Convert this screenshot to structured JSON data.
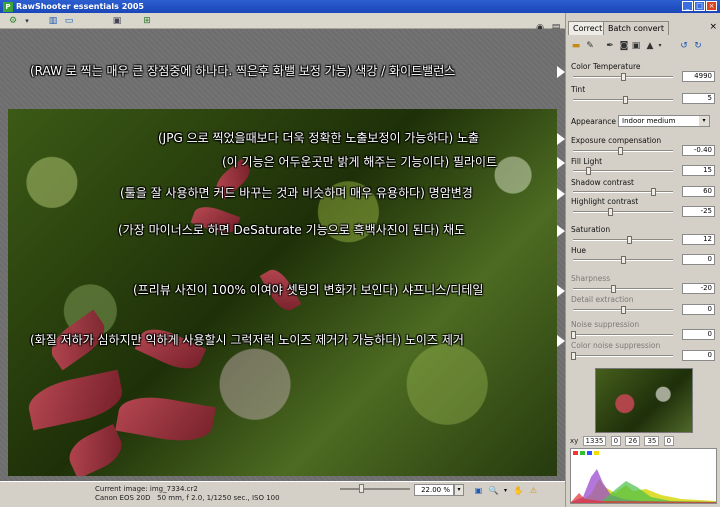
{
  "window": {
    "title": "RawShooter essentials 2005",
    "app_icon": "P",
    "buttons": [
      "_",
      "□",
      "×"
    ]
  },
  "toolbar": {
    "icons": [
      "settings-icon",
      "chevron-down-icon",
      "single-view-icon",
      "compare-view-icon",
      "monitor-icon",
      "batch-icon"
    ]
  },
  "annotations": [
    {
      "text": "(RAW 로 찍는 매우 큰 장점중에 하나다. 찍은후 화밸 보정 가능) 색강 / 화이트밸런스"
    },
    {
      "text": "(JPG 으로 찍었을때보다 더욱 정확한 노출보정이 가능하다) 노출"
    },
    {
      "text": "(이 기능은 어두운곳만 밝게 해주는 기능이다) 필라이트"
    },
    {
      "text": "(툴을 잘 사용하면 커드 바꾸는 것과 비슷하며 매우 유용하다) 명암변경"
    },
    {
      "text": "(가장 마이너스로 하면 DeSaturate 기능으로 흑백사진이 된다) 채도"
    },
    {
      "text": "(프리뷰 사진이 100% 이여야 셋팅의 변화가 보인다) 샤프니스/디테일"
    },
    {
      "text": "(화질 저하가 심하지만 익하게 사용할시 그럭저럭 노이즈 제거가 가능하다) 노이즈 제거"
    }
  ],
  "status": {
    "current_image": "Current image: img_7334.cr2",
    "camera": "Canon EOS 20D",
    "exposure": "50 mm, f 2.0, 1/1250 sec., ISO 100",
    "zoom": "22.00 %",
    "zoom_level": 0.3
  },
  "panel": {
    "tabs": [
      {
        "label": "Correct",
        "active": true
      },
      {
        "label": "Batch convert",
        "active": false
      }
    ],
    "tab_close": "×",
    "tools": [
      "folder-icon",
      "pin-icon",
      "eyedropper-icon",
      "camera-icon",
      "camera-small-icon",
      "levels-icon",
      "rotate-left-icon",
      "rotate-right-icon"
    ],
    "controls": [
      {
        "key": "color_temperature",
        "label": "Color Temperature",
        "value": "4990",
        "level": 0.5,
        "enabled": true
      },
      {
        "key": "tint",
        "label": "Tint",
        "value": "5",
        "level": 0.52,
        "enabled": true
      },
      {
        "key": "exposure",
        "label": "Exposure compensation",
        "value": "-0.40",
        "level": 0.47,
        "enabled": true
      },
      {
        "key": "fill_light",
        "label": "Fill Light",
        "value": "15",
        "level": 0.15,
        "enabled": true
      },
      {
        "key": "shadow_contrast",
        "label": "Shadow contrast",
        "value": "60",
        "level": 0.8,
        "enabled": true
      },
      {
        "key": "highlight_contrast",
        "label": "Highlight contrast",
        "value": "-25",
        "level": 0.37,
        "enabled": true
      },
      {
        "key": "saturation",
        "label": "Saturation",
        "value": "12",
        "level": 0.56,
        "enabled": true
      },
      {
        "key": "hue",
        "label": "Hue",
        "value": "0",
        "level": 0.5,
        "enabled": true
      },
      {
        "key": "sharpness",
        "label": "Sharpness",
        "value": "-20",
        "level": 0.4,
        "enabled": false
      },
      {
        "key": "detail_extraction",
        "label": "Detail extraction",
        "value": "0",
        "level": 0.5,
        "enabled": false
      },
      {
        "key": "noise_suppression",
        "label": "Noise suppression",
        "value": "0",
        "level": 0.0,
        "enabled": false
      },
      {
        "key": "color_noise_suppression",
        "label": "Color noise suppression",
        "value": "0",
        "level": 0.0,
        "enabled": false
      }
    ],
    "appearance": {
      "label": "Appearance",
      "value": "Indoor medium"
    },
    "xy": {
      "label": "xy",
      "x": "1335",
      "y": "0",
      "r": "26",
      "g": "35",
      "b": "0"
    },
    "histogram": {
      "swatches": [
        "#ff3030",
        "#30c030",
        "#3050ff",
        "#f0e000"
      ]
    }
  }
}
